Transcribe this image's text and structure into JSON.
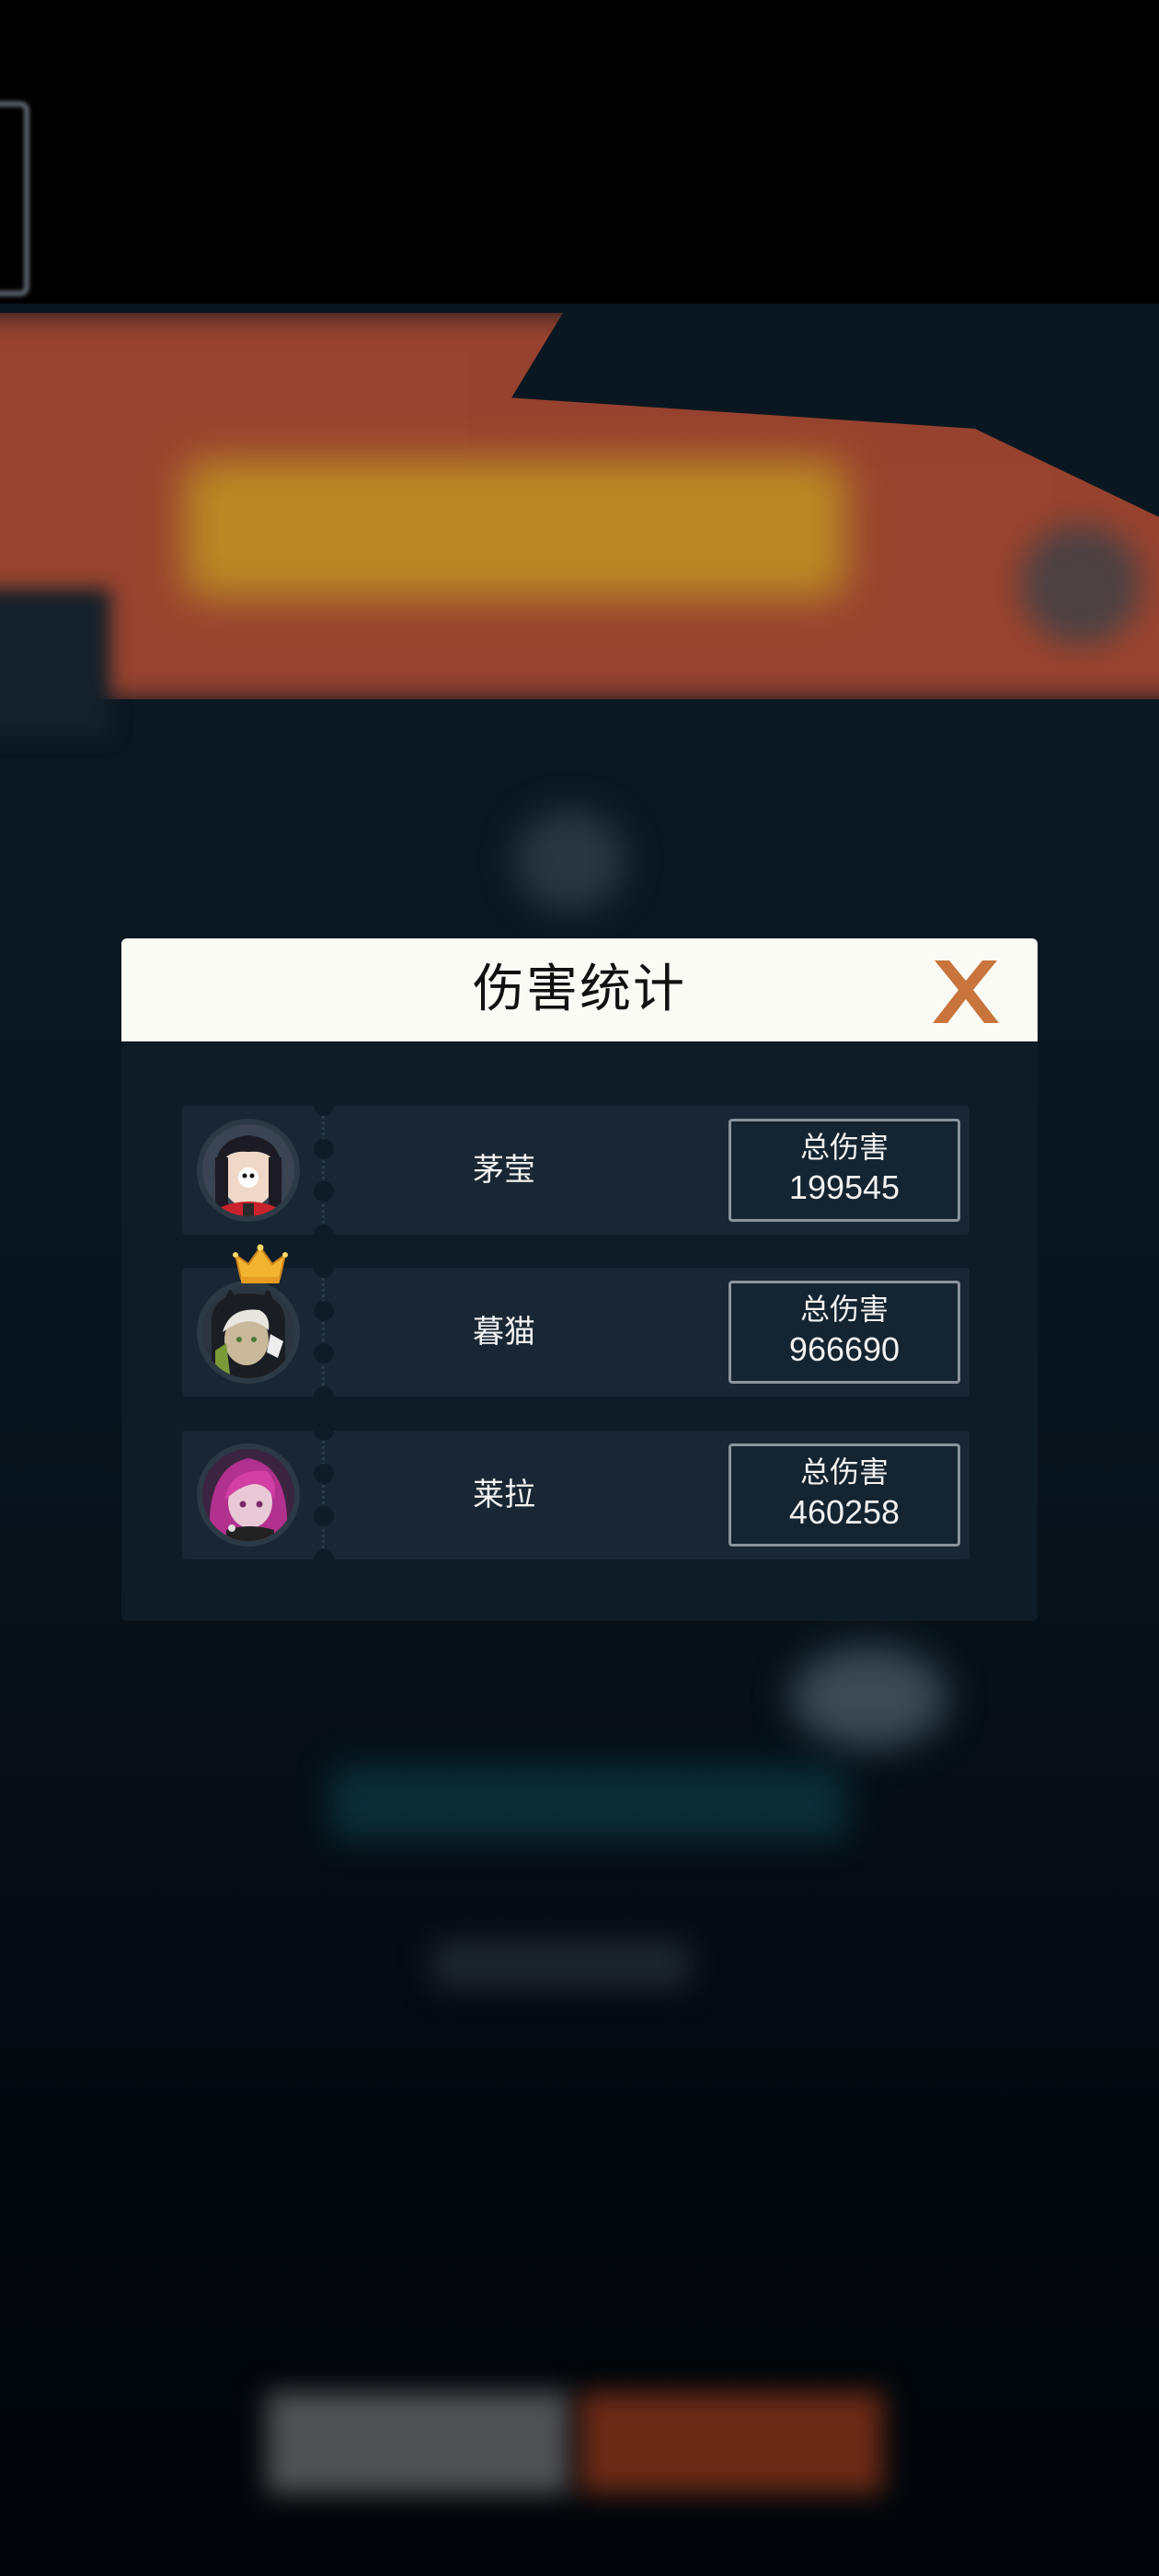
{
  "modal": {
    "title": "伤害统计",
    "close_icon": "close-x-icon"
  },
  "players": [
    {
      "name": "茅莹",
      "damage_label": "总伤害",
      "damage": "199545",
      "avatar_icon": "portrait-dark-hair-icon",
      "top_damage": false
    },
    {
      "name": "暮猫",
      "damage_label": "总伤害",
      "damage": "966690",
      "avatar_icon": "portrait-cat-ear-hood-icon",
      "top_damage": true
    },
    {
      "name": "莱拉",
      "damage_label": "总伤害",
      "damage": "460258",
      "avatar_icon": "portrait-pink-hair-icon",
      "top_damage": false
    }
  ],
  "colors": {
    "close": "#c8743c",
    "crown": "#f2b431",
    "panel": "#0d1c27",
    "header": "#fbfbf6"
  }
}
